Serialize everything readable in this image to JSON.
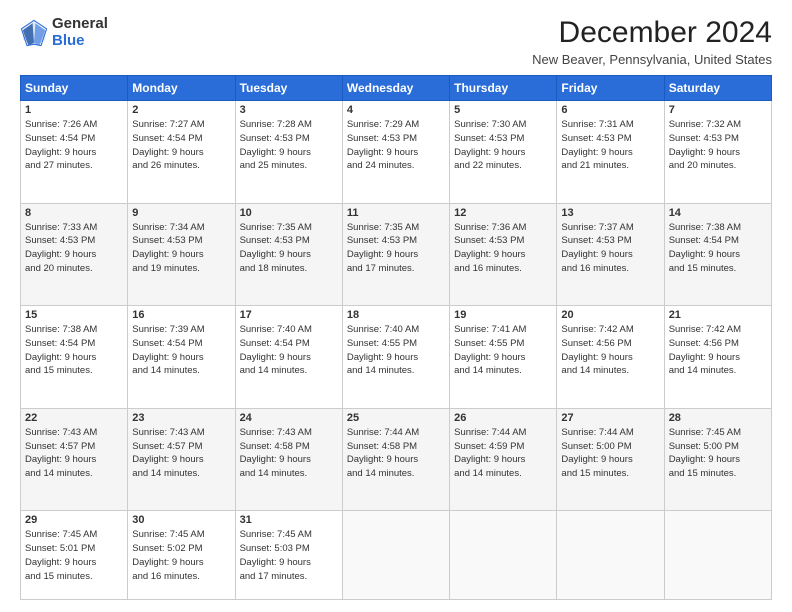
{
  "logo": {
    "general": "General",
    "blue": "Blue"
  },
  "title": "December 2024",
  "location": "New Beaver, Pennsylvania, United States",
  "headers": [
    "Sunday",
    "Monday",
    "Tuesday",
    "Wednesday",
    "Thursday",
    "Friday",
    "Saturday"
  ],
  "weeks": [
    [
      {
        "day": "1",
        "sunrise": "7:26 AM",
        "sunset": "4:54 PM",
        "daylight": "9 hours and 27 minutes."
      },
      {
        "day": "2",
        "sunrise": "7:27 AM",
        "sunset": "4:54 PM",
        "daylight": "9 hours and 26 minutes."
      },
      {
        "day": "3",
        "sunrise": "7:28 AM",
        "sunset": "4:53 PM",
        "daylight": "9 hours and 25 minutes."
      },
      {
        "day": "4",
        "sunrise": "7:29 AM",
        "sunset": "4:53 PM",
        "daylight": "9 hours and 24 minutes."
      },
      {
        "day": "5",
        "sunrise": "7:30 AM",
        "sunset": "4:53 PM",
        "daylight": "9 hours and 22 minutes."
      },
      {
        "day": "6",
        "sunrise": "7:31 AM",
        "sunset": "4:53 PM",
        "daylight": "9 hours and 21 minutes."
      },
      {
        "day": "7",
        "sunrise": "7:32 AM",
        "sunset": "4:53 PM",
        "daylight": "9 hours and 20 minutes."
      }
    ],
    [
      {
        "day": "8",
        "sunrise": "7:33 AM",
        "sunset": "4:53 PM",
        "daylight": "9 hours and 20 minutes."
      },
      {
        "day": "9",
        "sunrise": "7:34 AM",
        "sunset": "4:53 PM",
        "daylight": "9 hours and 19 minutes."
      },
      {
        "day": "10",
        "sunrise": "7:35 AM",
        "sunset": "4:53 PM",
        "daylight": "9 hours and 18 minutes."
      },
      {
        "day": "11",
        "sunrise": "7:35 AM",
        "sunset": "4:53 PM",
        "daylight": "9 hours and 17 minutes."
      },
      {
        "day": "12",
        "sunrise": "7:36 AM",
        "sunset": "4:53 PM",
        "daylight": "9 hours and 16 minutes."
      },
      {
        "day": "13",
        "sunrise": "7:37 AM",
        "sunset": "4:53 PM",
        "daylight": "9 hours and 16 minutes."
      },
      {
        "day": "14",
        "sunrise": "7:38 AM",
        "sunset": "4:54 PM",
        "daylight": "9 hours and 15 minutes."
      }
    ],
    [
      {
        "day": "15",
        "sunrise": "7:38 AM",
        "sunset": "4:54 PM",
        "daylight": "9 hours and 15 minutes."
      },
      {
        "day": "16",
        "sunrise": "7:39 AM",
        "sunset": "4:54 PM",
        "daylight": "9 hours and 14 minutes."
      },
      {
        "day": "17",
        "sunrise": "7:40 AM",
        "sunset": "4:54 PM",
        "daylight": "9 hours and 14 minutes."
      },
      {
        "day": "18",
        "sunrise": "7:40 AM",
        "sunset": "4:55 PM",
        "daylight": "9 hours and 14 minutes."
      },
      {
        "day": "19",
        "sunrise": "7:41 AM",
        "sunset": "4:55 PM",
        "daylight": "9 hours and 14 minutes."
      },
      {
        "day": "20",
        "sunrise": "7:42 AM",
        "sunset": "4:56 PM",
        "daylight": "9 hours and 14 minutes."
      },
      {
        "day": "21",
        "sunrise": "7:42 AM",
        "sunset": "4:56 PM",
        "daylight": "9 hours and 14 minutes."
      }
    ],
    [
      {
        "day": "22",
        "sunrise": "7:43 AM",
        "sunset": "4:57 PM",
        "daylight": "9 hours and 14 minutes."
      },
      {
        "day": "23",
        "sunrise": "7:43 AM",
        "sunset": "4:57 PM",
        "daylight": "9 hours and 14 minutes."
      },
      {
        "day": "24",
        "sunrise": "7:43 AM",
        "sunset": "4:58 PM",
        "daylight": "9 hours and 14 minutes."
      },
      {
        "day": "25",
        "sunrise": "7:44 AM",
        "sunset": "4:58 PM",
        "daylight": "9 hours and 14 minutes."
      },
      {
        "day": "26",
        "sunrise": "7:44 AM",
        "sunset": "4:59 PM",
        "daylight": "9 hours and 14 minutes."
      },
      {
        "day": "27",
        "sunrise": "7:44 AM",
        "sunset": "5:00 PM",
        "daylight": "9 hours and 15 minutes."
      },
      {
        "day": "28",
        "sunrise": "7:45 AM",
        "sunset": "5:00 PM",
        "daylight": "9 hours and 15 minutes."
      }
    ],
    [
      {
        "day": "29",
        "sunrise": "7:45 AM",
        "sunset": "5:01 PM",
        "daylight": "9 hours and 15 minutes."
      },
      {
        "day": "30",
        "sunrise": "7:45 AM",
        "sunset": "5:02 PM",
        "daylight": "9 hours and 16 minutes."
      },
      {
        "day": "31",
        "sunrise": "7:45 AM",
        "sunset": "5:03 PM",
        "daylight": "9 hours and 17 minutes."
      },
      null,
      null,
      null,
      null
    ]
  ],
  "labels": {
    "sunrise": "Sunrise:",
    "sunset": "Sunset:",
    "daylight": "Daylight:"
  }
}
